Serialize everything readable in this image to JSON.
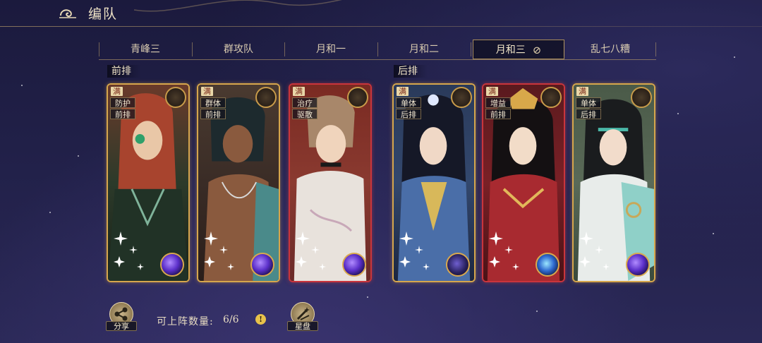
{
  "header": {
    "title": "编队",
    "back_icon": "cloud-swirl-back-icon"
  },
  "tabs": [
    {
      "label": "青峰三",
      "active": false
    },
    {
      "label": "群攻队",
      "active": false
    },
    {
      "label": "月和一",
      "active": false
    },
    {
      "label": "月和二",
      "active": false
    },
    {
      "label": "月和三",
      "active": true,
      "icon": "eye-slash-icon"
    },
    {
      "label": "乱七八糟",
      "active": false
    }
  ],
  "rows": {
    "front": "前排",
    "back": "后排"
  },
  "cards": [
    {
      "full": "满",
      "tags": [
        "防护",
        "前排"
      ],
      "frame": "gold",
      "orb": "purple-orb",
      "pet": "white-creature-icon"
    },
    {
      "full": "满",
      "tags": [
        "群体",
        "前排"
      ],
      "frame": "gold",
      "orb": "purple-orb",
      "pet": "green-snake-icon"
    },
    {
      "full": "满",
      "tags": [
        "治疗",
        "驱散"
      ],
      "frame": "red",
      "orb": "purple-orb",
      "pet": "white-bird-icon"
    },
    {
      "full": "满",
      "tags": [
        "单体",
        "后排"
      ],
      "frame": "gold",
      "orb": "dark-orb",
      "pet": "scorpion-icon"
    },
    {
      "full": "满",
      "tags": [
        "增益",
        "前排"
      ],
      "frame": "red",
      "orb": "blue-eye-orb",
      "pet": "white-bird-icon"
    },
    {
      "full": "满",
      "tags": [
        "单体",
        "后排"
      ],
      "frame": "gold",
      "orb": "purple-orb",
      "pet": "blue-bird-icon"
    }
  ],
  "footer": {
    "share_label": "分享",
    "deploy_label": "可上阵数量:",
    "deploy_count": "6/6",
    "info_icon": "!",
    "star_disk_label": "星盘"
  },
  "colors": {
    "gold_frame": "#d6a64c",
    "red_frame": "#c9353c",
    "background": "#22214a",
    "accent": "#e8c24a"
  }
}
